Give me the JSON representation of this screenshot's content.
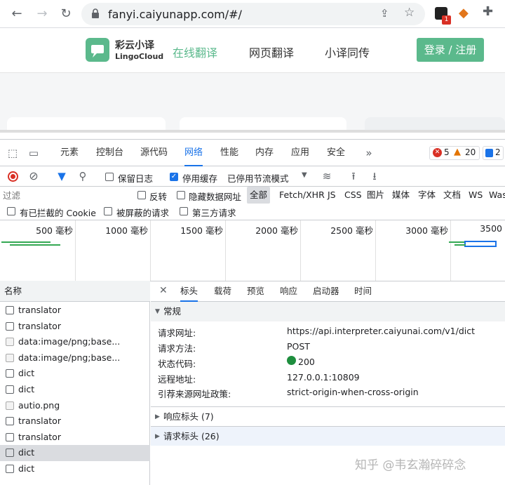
{
  "browser": {
    "url": "fanyi.caiyunapp.com/#/",
    "extension_badge": "1"
  },
  "site": {
    "logo_name": "彩云小译",
    "logo_sub": "LingoCloud",
    "nav": [
      "在线翻译",
      "网页翻译",
      "小译同传"
    ],
    "login": "登录 / 注册",
    "brand_color": "#5bb98c"
  },
  "devtools": {
    "tabs": [
      "元素",
      "控制台",
      "源代码",
      "网络",
      "性能",
      "内存",
      "应用",
      "安全"
    ],
    "active_tab": "网络",
    "errors": "5",
    "warnings": "20",
    "infos": "2",
    "toolbar": {
      "preserve_log": "保留日志",
      "disable_cache": "停用缓存",
      "throttle": "已停用节流模式"
    },
    "filter": {
      "placeholder": "过滤",
      "invert": "反转",
      "hide_data_urls": "隐藏数据网址",
      "types": [
        "全部",
        "Fetch/XHR",
        "JS",
        "CSS",
        "图片",
        "媒体",
        "字体",
        "文档",
        "WS",
        "Was"
      ],
      "blocked_cookies": "有已拦截的 Cookie",
      "blocked_requests": "被屏蔽的请求",
      "third_party": "第三方请求"
    },
    "timeline": [
      "500 毫秒",
      "1000 毫秒",
      "1500 毫秒",
      "2000 毫秒",
      "2500 毫秒",
      "3000 毫秒",
      "3500"
    ],
    "list_header": "名称",
    "requests": [
      {
        "name": "translator",
        "kind": "doc"
      },
      {
        "name": "translator",
        "kind": "doc"
      },
      {
        "name": "data:image/png;base...",
        "kind": "img"
      },
      {
        "name": "data:image/png;base...",
        "kind": "img"
      },
      {
        "name": "dict",
        "kind": "doc"
      },
      {
        "name": "dict",
        "kind": "doc"
      },
      {
        "name": "autio.png",
        "kind": "img"
      },
      {
        "name": "translator",
        "kind": "doc"
      },
      {
        "name": "translator",
        "kind": "doc"
      },
      {
        "name": "dict",
        "kind": "doc",
        "selected": true
      },
      {
        "name": "dict",
        "kind": "doc"
      }
    ],
    "detail_tabs": [
      "标头",
      "载荷",
      "预览",
      "响应",
      "启动器",
      "时间"
    ],
    "active_detail_tab": "标头",
    "general": {
      "title": "常规",
      "rows": [
        {
          "k": "请求网址:",
          "v": "https://api.interpreter.caiyunai.com/v1/dict"
        },
        {
          "k": "请求方法:",
          "v": "POST"
        },
        {
          "k": "状态代码:",
          "v": "200"
        },
        {
          "k": "远程地址:",
          "v": "127.0.0.1:10809"
        },
        {
          "k": "引荐来源网址政策:",
          "v": "strict-origin-when-cross-origin"
        }
      ]
    },
    "response_headers": "响应标头 (7)",
    "request_headers": "请求标头 (26)"
  },
  "watermark": "知乎 @韦玄瀚碎碎念"
}
